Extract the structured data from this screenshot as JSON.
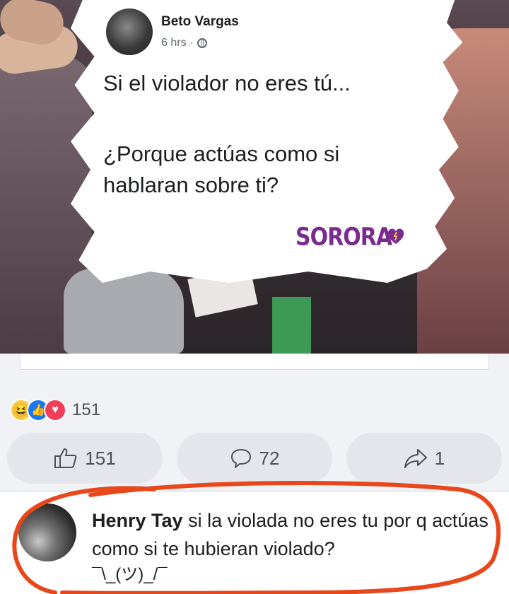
{
  "post": {
    "author": "Beto Vargas",
    "time": "6 hrs",
    "separator": "·",
    "privacy_icon": "globe-icon",
    "text_line1": "Si el violador no eres tú...",
    "text_line2": "¿Porque actúas como si hablaran sobre ti?",
    "brand": "SORORA"
  },
  "reactions": {
    "icons": [
      "haha-icon",
      "like-icon",
      "love-icon"
    ],
    "count": "151"
  },
  "actions": {
    "like_count": "151",
    "comment_count": "72",
    "share_count": "1"
  },
  "comment": {
    "author": "Henry Tay",
    "text": " si la violada no eres tu por q actúas como si te hubieran violado?",
    "shrug": "¯\\_(ツ)_/¯"
  },
  "colors": {
    "brand_purple": "#7b2a8e",
    "annotation_red": "#e8471c",
    "button_gray": "#e4e6eb"
  }
}
